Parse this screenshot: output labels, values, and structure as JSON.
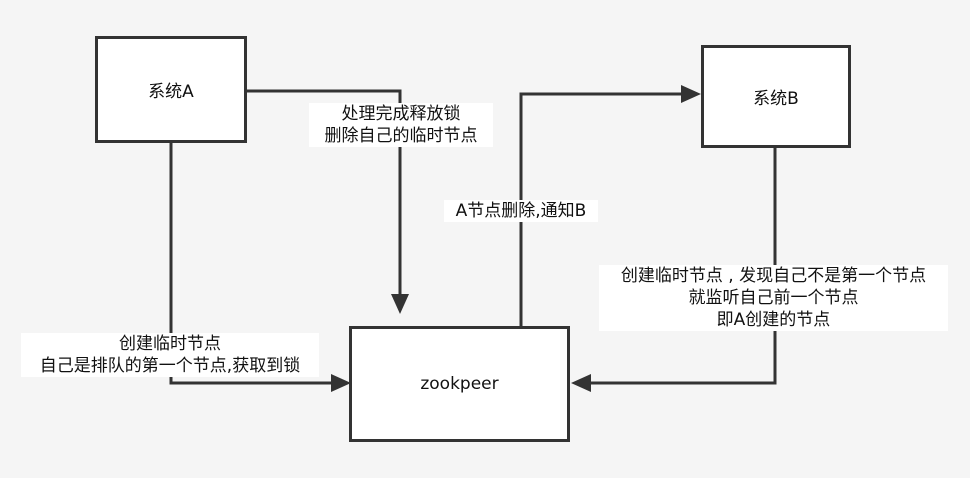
{
  "nodes": {
    "system_a": "系统A",
    "system_b": "系统B",
    "zookeeper": "zookpeer"
  },
  "labels": {
    "release": [
      "处理完成释放锁",
      "删除自己的临时节点"
    ],
    "notify": "A节点删除,通知B",
    "b_create": [
      "创建临时节点 , 发现自己不是第一个节点",
      "就监听自己前一个节点",
      "即A创建的节点"
    ],
    "a_create": [
      "创建临时节点",
      "自己是排队的第一个节点,获取到锁"
    ]
  },
  "colors": {
    "background": "#f5f5f5",
    "line": "#333333",
    "box_fill": "#ffffff"
  }
}
